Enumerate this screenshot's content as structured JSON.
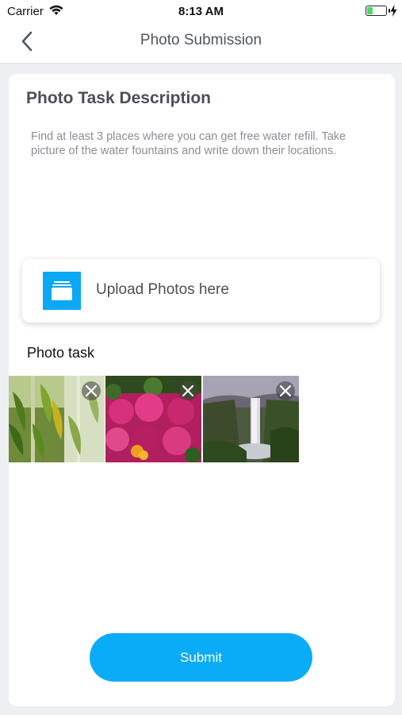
{
  "status_bar": {
    "carrier": "Carrier",
    "time": "8:13 AM",
    "wifi_icon": "wifi-icon",
    "battery_icon": "battery-icon",
    "battery_level": 0.3,
    "battery_color": "#4cd964"
  },
  "nav": {
    "title": "Photo Submission",
    "back_icon": "chevron-left-icon"
  },
  "task": {
    "title": "Photo Task Description",
    "description": "Find at least 3 places where you can get free water refill. Take picture of the water fountains and write down their locations."
  },
  "upload": {
    "label": "Upload Photos here",
    "icon": "photo-stack-icon"
  },
  "photo_section": {
    "label": "Photo task",
    "photos": [
      {
        "subject": "bamboo-leaves",
        "remove_icon": "close-icon"
      },
      {
        "subject": "pink-flowers",
        "remove_icon": "close-icon"
      },
      {
        "subject": "waterfall",
        "remove_icon": "close-icon"
      }
    ]
  },
  "submit": {
    "label": "Submit"
  },
  "colors": {
    "accent": "#0aacf7",
    "background": "#eeeff2",
    "card": "#ffffff",
    "title_text": "#4a4f57",
    "description_text": "#8a8e95"
  }
}
